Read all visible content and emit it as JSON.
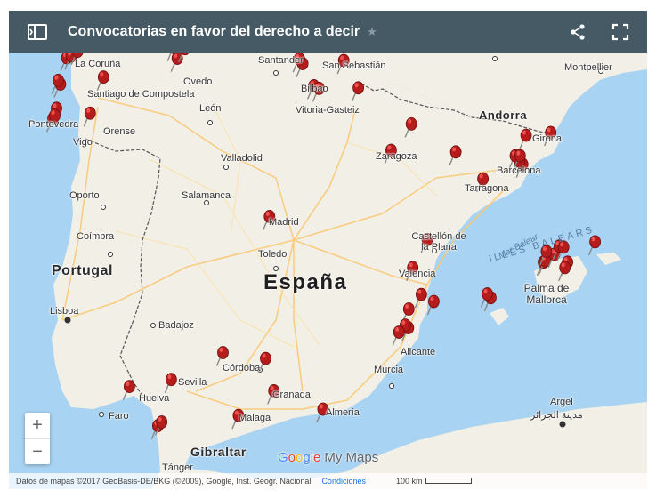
{
  "header": {
    "title": "Convocatorias en favor del derecho a decir",
    "colors": {
      "bar": "#455a64",
      "text": "#ffffff"
    }
  },
  "map": {
    "countries": [
      {
        "key": "espana",
        "name": "España"
      },
      {
        "key": "portugal",
        "name": "Portugal"
      },
      {
        "key": "andorra",
        "name": "Andorra"
      },
      {
        "key": "gibraltar",
        "name": "Gibraltar"
      }
    ],
    "regions": [
      {
        "key": "illes_balears",
        "name": "ILLES BALEARS"
      },
      {
        "key": "mar_balear",
        "name": "Mar Balear"
      }
    ],
    "cities": [
      {
        "key": "la_coruna",
        "name": "La Coruña"
      },
      {
        "key": "oviedo",
        "name": "Ovedo"
      },
      {
        "key": "santander",
        "name": "Santander"
      },
      {
        "key": "san_sebastian",
        "name": "San Sebastián"
      },
      {
        "key": "montpellier",
        "name": "Montpellier"
      },
      {
        "key": "santiago",
        "name": "Santiago de Compostela"
      },
      {
        "key": "leon",
        "name": "León"
      },
      {
        "key": "bilbao",
        "name": "Bilbao"
      },
      {
        "key": "vitoria",
        "name": "Vitoria-Gasteiz"
      },
      {
        "key": "pontevedra",
        "name": "Pontevedra"
      },
      {
        "key": "vigo",
        "name": "Vigo"
      },
      {
        "key": "orense",
        "name": "Orense"
      },
      {
        "key": "zaragoza",
        "name": "Zaragoza"
      },
      {
        "key": "girona",
        "name": "Girona"
      },
      {
        "key": "valladolid",
        "name": "Valladolid"
      },
      {
        "key": "barcelona",
        "name": "Barcelona"
      },
      {
        "key": "oporto",
        "name": "Oporto"
      },
      {
        "key": "salamanca",
        "name": "Salamanca"
      },
      {
        "key": "tarragona",
        "name": "Tarragona"
      },
      {
        "key": "madrid",
        "name": "Madrid"
      },
      {
        "key": "coimbra",
        "name": "Coímbra"
      },
      {
        "key": "castellon",
        "name": "Castellón de la Plana"
      },
      {
        "key": "toledo",
        "name": "Toledo"
      },
      {
        "key": "valencia",
        "name": "Valencia"
      },
      {
        "key": "palma",
        "name": "Palma de Mallorca"
      },
      {
        "key": "lisboa",
        "name": "Lisboa"
      },
      {
        "key": "badajoz",
        "name": "Badajoz"
      },
      {
        "key": "cordoba",
        "name": "Córdoba"
      },
      {
        "key": "alicante",
        "name": "Alicante"
      },
      {
        "key": "murcia",
        "name": "Murcia"
      },
      {
        "key": "sevilla",
        "name": "Sevilla"
      },
      {
        "key": "huelva",
        "name": "Huelva"
      },
      {
        "key": "granada",
        "name": "Granada"
      },
      {
        "key": "faro",
        "name": "Faro"
      },
      {
        "key": "almeria",
        "name": "Almería"
      },
      {
        "key": "malaga",
        "name": "Málaga"
      },
      {
        "key": "argel",
        "name": "Argel"
      },
      {
        "key": "argel_ar",
        "name": "مدينة الجزائر"
      },
      {
        "key": "tanger",
        "name": "Tánger"
      }
    ],
    "pins": [
      {
        "place": "La Coruña",
        "lon": -8.4,
        "lat": 43.37
      },
      {
        "place": "La Coruña",
        "lon": -8.3,
        "lat": 43.4
      },
      {
        "place": "Ferrol",
        "lon": -8.15,
        "lat": 43.49
      },
      {
        "place": "Santiago de Compostela",
        "lon": -8.55,
        "lat": 42.88
      },
      {
        "place": "Santiago de Compostela",
        "lon": -8.6,
        "lat": 42.95
      },
      {
        "place": "Lugo",
        "lon": -7.55,
        "lat": 43.01
      },
      {
        "place": "Pontevedra",
        "lon": -8.64,
        "lat": 42.43
      },
      {
        "place": "Vigo",
        "lon": -8.72,
        "lat": 42.24
      },
      {
        "place": "Vigo",
        "lon": -8.68,
        "lat": 42.3
      },
      {
        "place": "Orense",
        "lon": -7.86,
        "lat": 42.34
      },
      {
        "place": "Oviedo",
        "lon": -5.84,
        "lat": 43.36
      },
      {
        "place": "Gijón",
        "lon": -5.66,
        "lat": 43.54
      },
      {
        "place": "Avilés",
        "lon": -5.92,
        "lat": 43.56
      },
      {
        "place": "Bilbao",
        "lon": -2.93,
        "lat": 43.26
      },
      {
        "place": "Getxo",
        "lon": -3.01,
        "lat": 43.35
      },
      {
        "place": "Vitoria-Gasteiz",
        "lon": -2.67,
        "lat": 42.85
      },
      {
        "place": "Vitoria-Gasteiz",
        "lon": -2.55,
        "lat": 42.8
      },
      {
        "place": "San Sebastián",
        "lon": -1.98,
        "lat": 43.32
      },
      {
        "place": "Pamplona",
        "lon": -1.64,
        "lat": 42.81
      },
      {
        "place": "Huesca",
        "lon": -0.41,
        "lat": 42.14
      },
      {
        "place": "Zaragoza",
        "lon": -0.88,
        "lat": 41.65
      },
      {
        "place": "Lleida",
        "lon": 0.62,
        "lat": 41.62
      },
      {
        "place": "Tarragona",
        "lon": 1.25,
        "lat": 41.12
      },
      {
        "place": "Barcelona",
        "lon": 2.17,
        "lat": 41.39
      },
      {
        "place": "Barcelona",
        "lon": 2.1,
        "lat": 41.45
      },
      {
        "place": "Barcelona",
        "lon": 2.0,
        "lat": 41.55
      },
      {
        "place": "Sabadell",
        "lon": 2.11,
        "lat": 41.55
      },
      {
        "place": "Girona",
        "lon": 2.82,
        "lat": 41.98
      },
      {
        "place": "Vic",
        "lon": 2.25,
        "lat": 41.93
      },
      {
        "place": "Madrid",
        "lon": -3.7,
        "lat": 40.42
      },
      {
        "place": "Castellón de la Plana",
        "lon": -0.04,
        "lat": 39.99
      },
      {
        "place": "Valencia",
        "lon": -0.38,
        "lat": 39.47
      },
      {
        "place": "Gandía",
        "lon": -0.18,
        "lat": 38.97
      },
      {
        "place": "Dénia",
        "lon": 0.11,
        "lat": 38.84
      },
      {
        "place": "Alcoy",
        "lon": -0.47,
        "lat": 38.7
      },
      {
        "place": "Alicante",
        "lon": -0.48,
        "lat": 38.35
      },
      {
        "place": "Alicante",
        "lon": -0.55,
        "lat": 38.4
      },
      {
        "place": "Elche",
        "lon": -0.7,
        "lat": 38.27
      },
      {
        "place": "Ibiza",
        "lon": 1.43,
        "lat": 38.91
      },
      {
        "place": "Ibiza",
        "lon": 1.35,
        "lat": 38.98
      },
      {
        "place": "Palma de Mallorca",
        "lon": 2.65,
        "lat": 39.57
      },
      {
        "place": "Palma de Mallorca",
        "lon": 2.7,
        "lat": 39.6
      },
      {
        "place": "Inca",
        "lon": 2.91,
        "lat": 39.72
      },
      {
        "place": "Manacor",
        "lon": 3.21,
        "lat": 39.57
      },
      {
        "place": "Pollença",
        "lon": 3.02,
        "lat": 39.87
      },
      {
        "place": "Sóller",
        "lon": 2.72,
        "lat": 39.77
      },
      {
        "place": "Felanitx",
        "lon": 3.15,
        "lat": 39.47
      },
      {
        "place": "Alcúdia",
        "lon": 3.12,
        "lat": 39.85
      },
      {
        "place": "Menorca",
        "lon": 3.85,
        "lat": 39.95
      },
      {
        "place": "Córdoba",
        "lon": -4.78,
        "lat": 37.89
      },
      {
        "place": "Jaén",
        "lon": -3.79,
        "lat": 37.78
      },
      {
        "place": "Sevilla",
        "lon": -5.98,
        "lat": 37.39
      },
      {
        "place": "Huelva",
        "lon": -6.95,
        "lat": 37.26
      },
      {
        "place": "Granada",
        "lon": -3.6,
        "lat": 37.18
      },
      {
        "place": "Málaga",
        "lon": -4.42,
        "lat": 36.72
      },
      {
        "place": "Almería",
        "lon": -2.46,
        "lat": 36.84
      },
      {
        "place": "Cádiz",
        "lon": -6.29,
        "lat": 36.53
      },
      {
        "place": "Algeciras",
        "lon": -6.2,
        "lat": 36.6
      }
    ],
    "colors": {
      "sea": "#a9d3f2",
      "land": "#f2efe6",
      "pin": "#b71c1c",
      "pin_highlight": "#ef5350",
      "border": "#555555",
      "road_major": "#f9c977",
      "road_minor": "#fbe1a7"
    }
  },
  "controls": {
    "zoom_in": "+",
    "zoom_out": "−"
  },
  "branding": {
    "google": [
      "G",
      "o",
      "o",
      "g",
      "l",
      "e"
    ],
    "product": "My Maps"
  },
  "footer": {
    "attribution": "Datos de mapas ©2017 GeoBasis-DE/BKG (©2009), Google, Inst. Geogr. Nacional",
    "terms": "Condiciones",
    "scale": "100 km"
  }
}
